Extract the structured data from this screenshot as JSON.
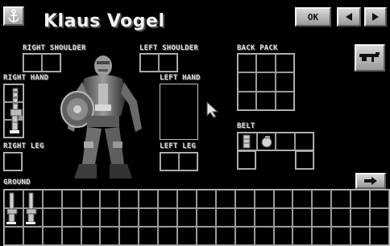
{
  "header": {
    "character_name": "Klaus Vogel",
    "ok_label": "OK",
    "prev_icon": "triangle-left-icon",
    "next_icon": "triangle-right-icon",
    "rank_icon": "anchor-icon"
  },
  "slots": {
    "right_shoulder": "RIGHT SHOULDER",
    "left_shoulder": "LEFT SHOULDER",
    "right_hand": "RIGHT HAND",
    "left_hand": "LEFT HAND",
    "right_leg": "RIGHT LEG",
    "left_leg": "LEFT LEG",
    "back_pack": "BACK PACK",
    "belt": "BELT",
    "ground": "GROUND"
  },
  "items": {
    "right_hand_item": "rifle-clip-icon",
    "belt_items": [
      "ammo-clip-icon",
      "grenade-icon"
    ],
    "ground_items": [
      "rifle-clip-icon",
      "rifle-clip-icon"
    ],
    "weapon_button_icon": "rifle-icon",
    "ground_scroll_icon": "arrow-right-icon"
  }
}
